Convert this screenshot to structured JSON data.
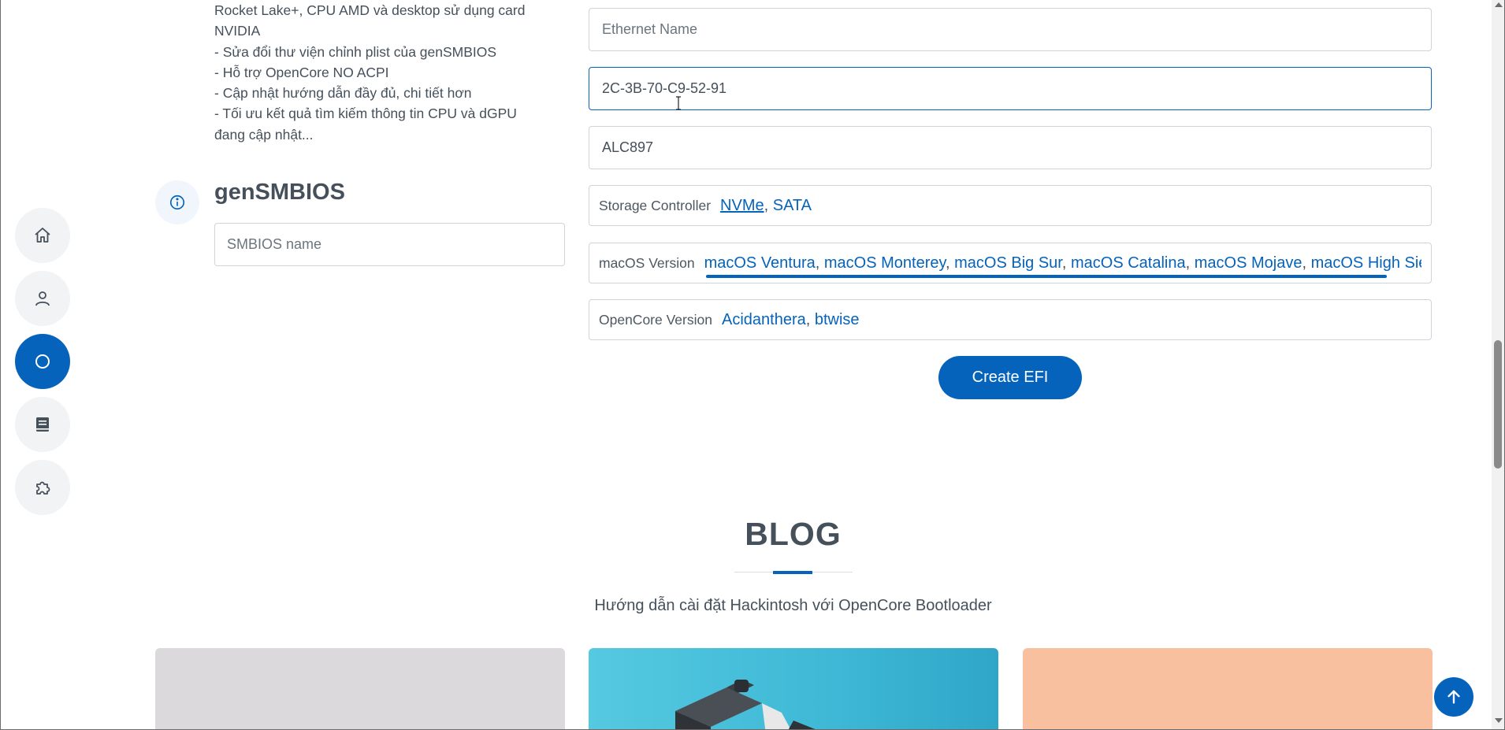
{
  "nav": {
    "items": [
      {
        "icon": "home-icon",
        "active": false
      },
      {
        "icon": "user-icon",
        "active": false
      },
      {
        "icon": "circle-icon",
        "active": true
      },
      {
        "icon": "book-icon",
        "active": false
      },
      {
        "icon": "puzzle-icon",
        "active": false
      }
    ]
  },
  "changelog": {
    "lines": [
      "Rocket Lake+, CPU AMD và desktop sử dụng card",
      "NVIDIA",
      "- Sửa đổi thư viện chỉnh plist của genSMBIOS",
      "- Hỗ trợ OpenCore NO ACPI",
      "- Cập nhật hướng dẫn đầy đủ, chi tiết hơn",
      "- Tối ưu kết quả tìm kiếm thông tin CPU và dGPU",
      "đang cập nhật..."
    ]
  },
  "gensmbios": {
    "title": "genSMBIOS",
    "placeholder": "SMBIOS name"
  },
  "form": {
    "ethernet_placeholder": "Ethernet Name",
    "mac_value": "2C-3B-70-C9-52-91",
    "audio_value": "ALC897",
    "storage": {
      "label": "Storage Controller",
      "values": [
        "NVMe",
        "SATA"
      ]
    },
    "macos": {
      "label": "macOS Version",
      "values": [
        "macOS Ventura",
        "macOS Monterey",
        "macOS Big Sur",
        "macOS Catalina",
        "macOS Mojave",
        "macOS High Sierra"
      ]
    },
    "opencore": {
      "label": "OpenCore Version",
      "values": [
        "Acidanthera",
        "btwise"
      ]
    },
    "create_button": "Create EFI"
  },
  "blog": {
    "title": "BLOG",
    "subtitle": "Hướng dẫn cài đặt Hackintosh với OpenCore Bootloader"
  },
  "colors": {
    "accent": "#0563bb",
    "text": "#45505b",
    "nav_bg": "#f2f3f5"
  }
}
